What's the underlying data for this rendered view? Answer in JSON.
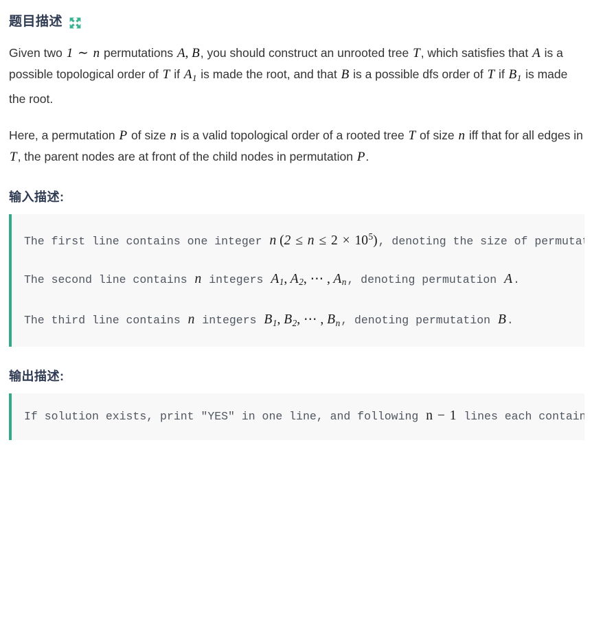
{
  "header": {
    "title": "题目描述",
    "expand_icon": "expand-arrows-icon",
    "accent_color": "#32ab8b",
    "title_color": "#2f3b52"
  },
  "description": {
    "paragraphs": [
      {
        "id": "p1",
        "parts": [
          {
            "t": "text",
            "v": "Given two "
          },
          {
            "t": "math",
            "v": "1 ∼ n"
          },
          {
            "t": "text",
            "v": " permutations "
          },
          {
            "t": "math",
            "v": "A, B"
          },
          {
            "t": "text",
            "v": ", you should construct an unrooted tree "
          },
          {
            "t": "math",
            "v": "T"
          },
          {
            "t": "text",
            "v": ", which satisfies that "
          },
          {
            "t": "math",
            "v": "A"
          },
          {
            "t": "text",
            "v": " is a possible topological order of "
          },
          {
            "t": "math",
            "v": "T"
          },
          {
            "t": "text",
            "v": " if "
          },
          {
            "t": "math",
            "v": "A₁"
          },
          {
            "t": "text",
            "v": " is made the root, and that "
          },
          {
            "t": "math",
            "v": "B"
          },
          {
            "t": "text",
            "v": " is a possible dfs order of "
          },
          {
            "t": "math",
            "v": "T"
          },
          {
            "t": "text",
            "v": " if "
          },
          {
            "t": "math",
            "v": "B₁"
          },
          {
            "t": "text",
            "v": " is made the root."
          }
        ]
      },
      {
        "id": "p2",
        "parts": [
          {
            "t": "text",
            "v": "Here, a permutation "
          },
          {
            "t": "math",
            "v": "P"
          },
          {
            "t": "text",
            "v": " of size "
          },
          {
            "t": "math",
            "v": "n"
          },
          {
            "t": "text",
            "v": " is a valid topological order of a rooted tree "
          },
          {
            "t": "math",
            "v": "T"
          },
          {
            "t": "text",
            "v": " of size "
          },
          {
            "t": "math",
            "v": "n"
          },
          {
            "t": "text",
            "v": " iff that for all edges in "
          },
          {
            "t": "math",
            "v": "T"
          },
          {
            "t": "text",
            "v": ", the parent nodes are at front of the child nodes in permutation "
          },
          {
            "t": "math",
            "v": "P"
          },
          {
            "t": "text",
            "v": "."
          }
        ]
      }
    ]
  },
  "input_section": {
    "title": "输入描述:",
    "lines": [
      "The first line contains one integer n (2 ≤ n ≤ 2 × 10^5), denoting the size of permutations.",
      "The second line contains n integers A₁, A₂, ⋯ , Aₙ, denoting permutation A.",
      "The third line contains n integers B₁, B₂, ⋯ , Bₙ, denoting permutation B."
    ]
  },
  "output_section": {
    "title": "输出描述:",
    "lines": [
      "If solution exists, print \"YES\" in one line, and following n − 1 lines each contains two integers u, v (1 ≤ u, v ≤ n, u ≠ v), denoting one edge in T. If multiple solutions exist, print any one of them. If no solution, print \"NO\" in one line."
    ]
  },
  "theme": {
    "block_background": "#f8f8f9",
    "block_border": "#32ab8b",
    "body_text": "#333333",
    "code_text": "#50565f"
  }
}
